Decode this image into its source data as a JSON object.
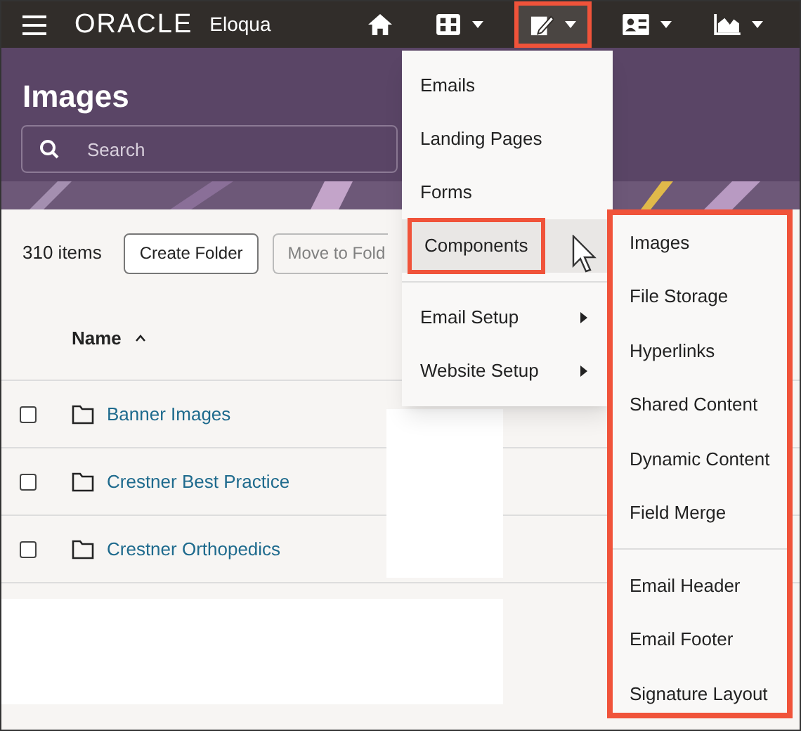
{
  "top_bar": {
    "logo": "ORACLE",
    "product": "Eloqua",
    "nav": [
      {
        "kind": "home",
        "caret": false,
        "selected": false
      },
      {
        "kind": "grid",
        "caret": true,
        "selected": false
      },
      {
        "kind": "pencil",
        "caret": true,
        "selected": true
      },
      {
        "kind": "card",
        "caret": true,
        "selected": false
      },
      {
        "kind": "chart",
        "caret": true,
        "selected": false
      }
    ]
  },
  "page": {
    "title": "Images",
    "search": {
      "placeholder": "Search"
    }
  },
  "toolbar": {
    "count": "310 items",
    "buttons": [
      {
        "label": "Create Folder",
        "disabled": false
      },
      {
        "label": "Move to Fold",
        "disabled": true
      }
    ]
  },
  "table": {
    "columns": [
      {
        "label": "Name",
        "sorted_ascending": true
      }
    ],
    "rows": [
      {
        "name": "Banner Images",
        "checked": false
      },
      {
        "name": "Crestner Best Practice",
        "checked": false
      },
      {
        "name": "Crestner Orthopedics",
        "checked": false
      }
    ]
  },
  "menu": {
    "groups": [
      [
        {
          "label": "Emails",
          "submenu": false,
          "selected": false
        },
        {
          "label": "Landing Pages",
          "submenu": false,
          "selected": false
        },
        {
          "label": "Forms",
          "submenu": false,
          "selected": false
        },
        {
          "label": "Components",
          "submenu": false,
          "selected": true
        }
      ],
      [
        {
          "label": "Email Setup",
          "submenu": true,
          "selected": false
        },
        {
          "label": "Website Setup",
          "submenu": true,
          "selected": false
        }
      ]
    ]
  },
  "submenu": {
    "highlighted": true,
    "groups": [
      [
        {
          "label": "Images"
        },
        {
          "label": "File Storage"
        },
        {
          "label": "Hyperlinks"
        },
        {
          "label": "Shared Content"
        },
        {
          "label": "Dynamic Content"
        },
        {
          "label": "Field Merge"
        }
      ],
      [
        {
          "label": "Email Header"
        },
        {
          "label": "Email Footer"
        },
        {
          "label": "Signature Layout"
        }
      ]
    ]
  }
}
